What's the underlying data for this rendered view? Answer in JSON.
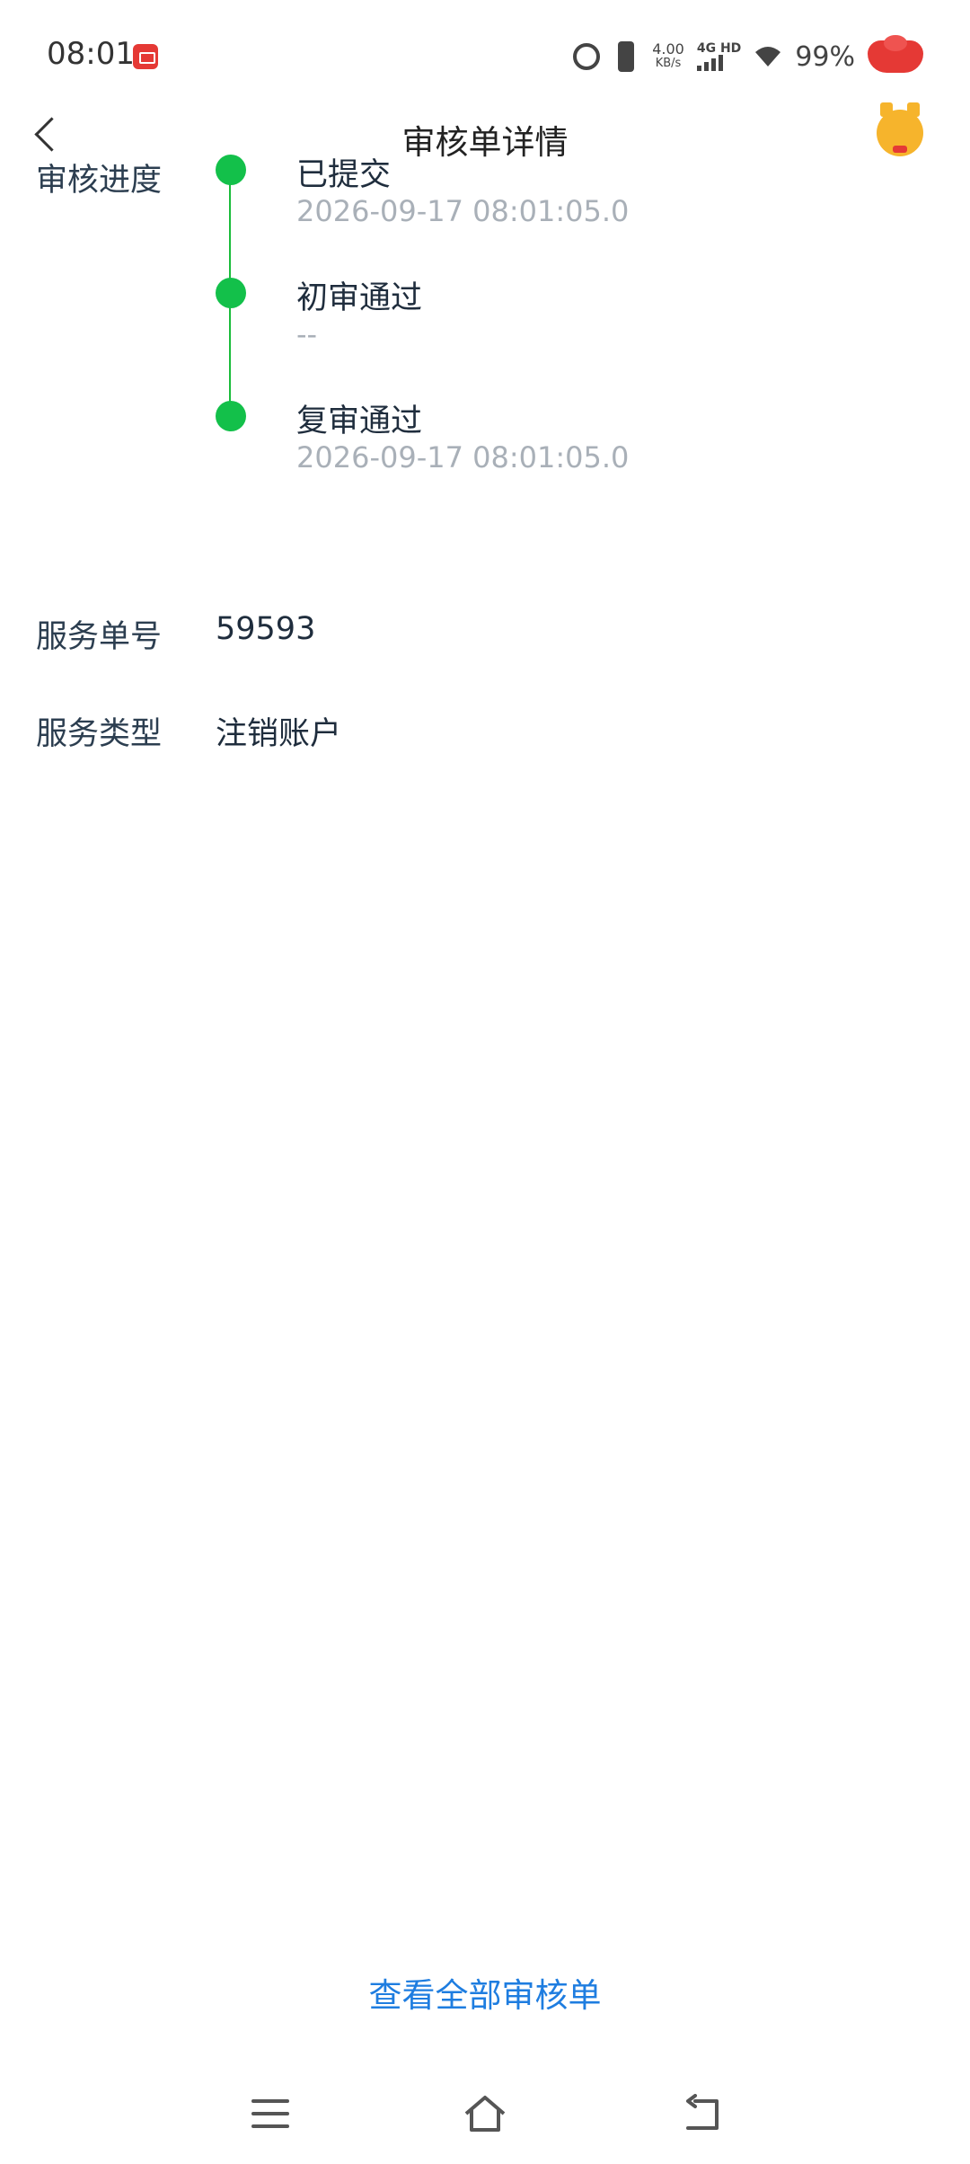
{
  "status_bar": {
    "time": "08:01",
    "net_speed_value": "4.00",
    "net_speed_unit": "KB/s",
    "network_type": "4G HD",
    "battery": "99%"
  },
  "header": {
    "title": "审核单详情"
  },
  "progress": {
    "label": "审核进度",
    "steps": [
      {
        "title": "已提交",
        "time": "2026-09-17 08:01:05.0"
      },
      {
        "title": "初审通过",
        "time": "--"
      },
      {
        "title": "复审通过",
        "time": "2026-09-17 08:01:05.0"
      }
    ],
    "accent_color": "#13c04a"
  },
  "service_number": {
    "label": "服务单号",
    "value": "59593"
  },
  "service_type": {
    "label": "服务类型",
    "value": "注销账户"
  },
  "footer": {
    "link_label": "查看全部审核单",
    "link_color": "#1e7de0"
  },
  "icons": {
    "back": "back-arrow-icon",
    "mascot": "deer-mascot-icon",
    "nav_menu": "menu-icon",
    "nav_home": "home-icon",
    "nav_back": "back-icon"
  }
}
